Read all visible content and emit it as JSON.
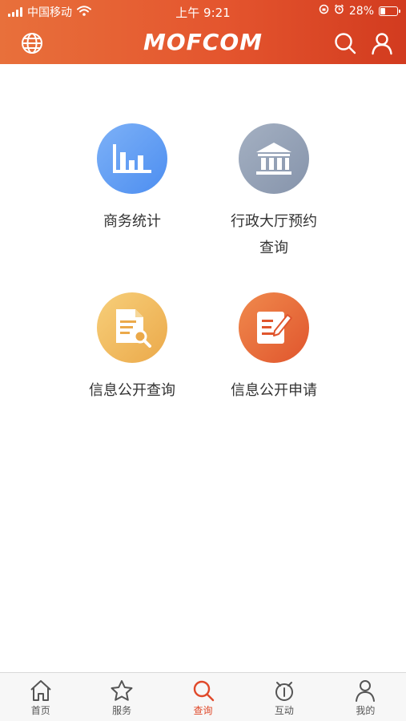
{
  "status_bar": {
    "carrier": "中国移动",
    "time": "上午 9:21",
    "battery_percent": "28%",
    "battery_level": 0.28,
    "icons": [
      "signal-bars-icon",
      "wifi-icon",
      "rotation-lock-icon",
      "alarm-icon",
      "battery-icon"
    ]
  },
  "nav": {
    "logo_text": "MOFCOM",
    "left_icon": "globe-icon",
    "right_icons": [
      "search-icon",
      "user-icon"
    ]
  },
  "grid": {
    "items": [
      {
        "label": "商务统计",
        "icon": "bar-chart-icon",
        "color": "#5f9cf3"
      },
      {
        "label": "行政大厅预约查询",
        "icon": "government-building-icon",
        "color": "#95a1b6"
      },
      {
        "label": "信息公开查询",
        "icon": "document-search-icon",
        "color": "#f0bb5f"
      },
      {
        "label": "信息公开申请",
        "icon": "edit-form-icon",
        "color": "#e76b3c"
      }
    ]
  },
  "tab_bar": {
    "active_index": 2,
    "active_color": "#e0492a",
    "items": [
      {
        "label": "首页",
        "icon": "home-icon"
      },
      {
        "label": "服务",
        "icon": "star-icon"
      },
      {
        "label": "查询",
        "icon": "search-icon"
      },
      {
        "label": "互动",
        "icon": "interact-icon"
      },
      {
        "label": "我的",
        "icon": "user-icon"
      }
    ]
  },
  "theme": {
    "header_gradient": [
      "#e8703b",
      "#d23b1f"
    ]
  }
}
